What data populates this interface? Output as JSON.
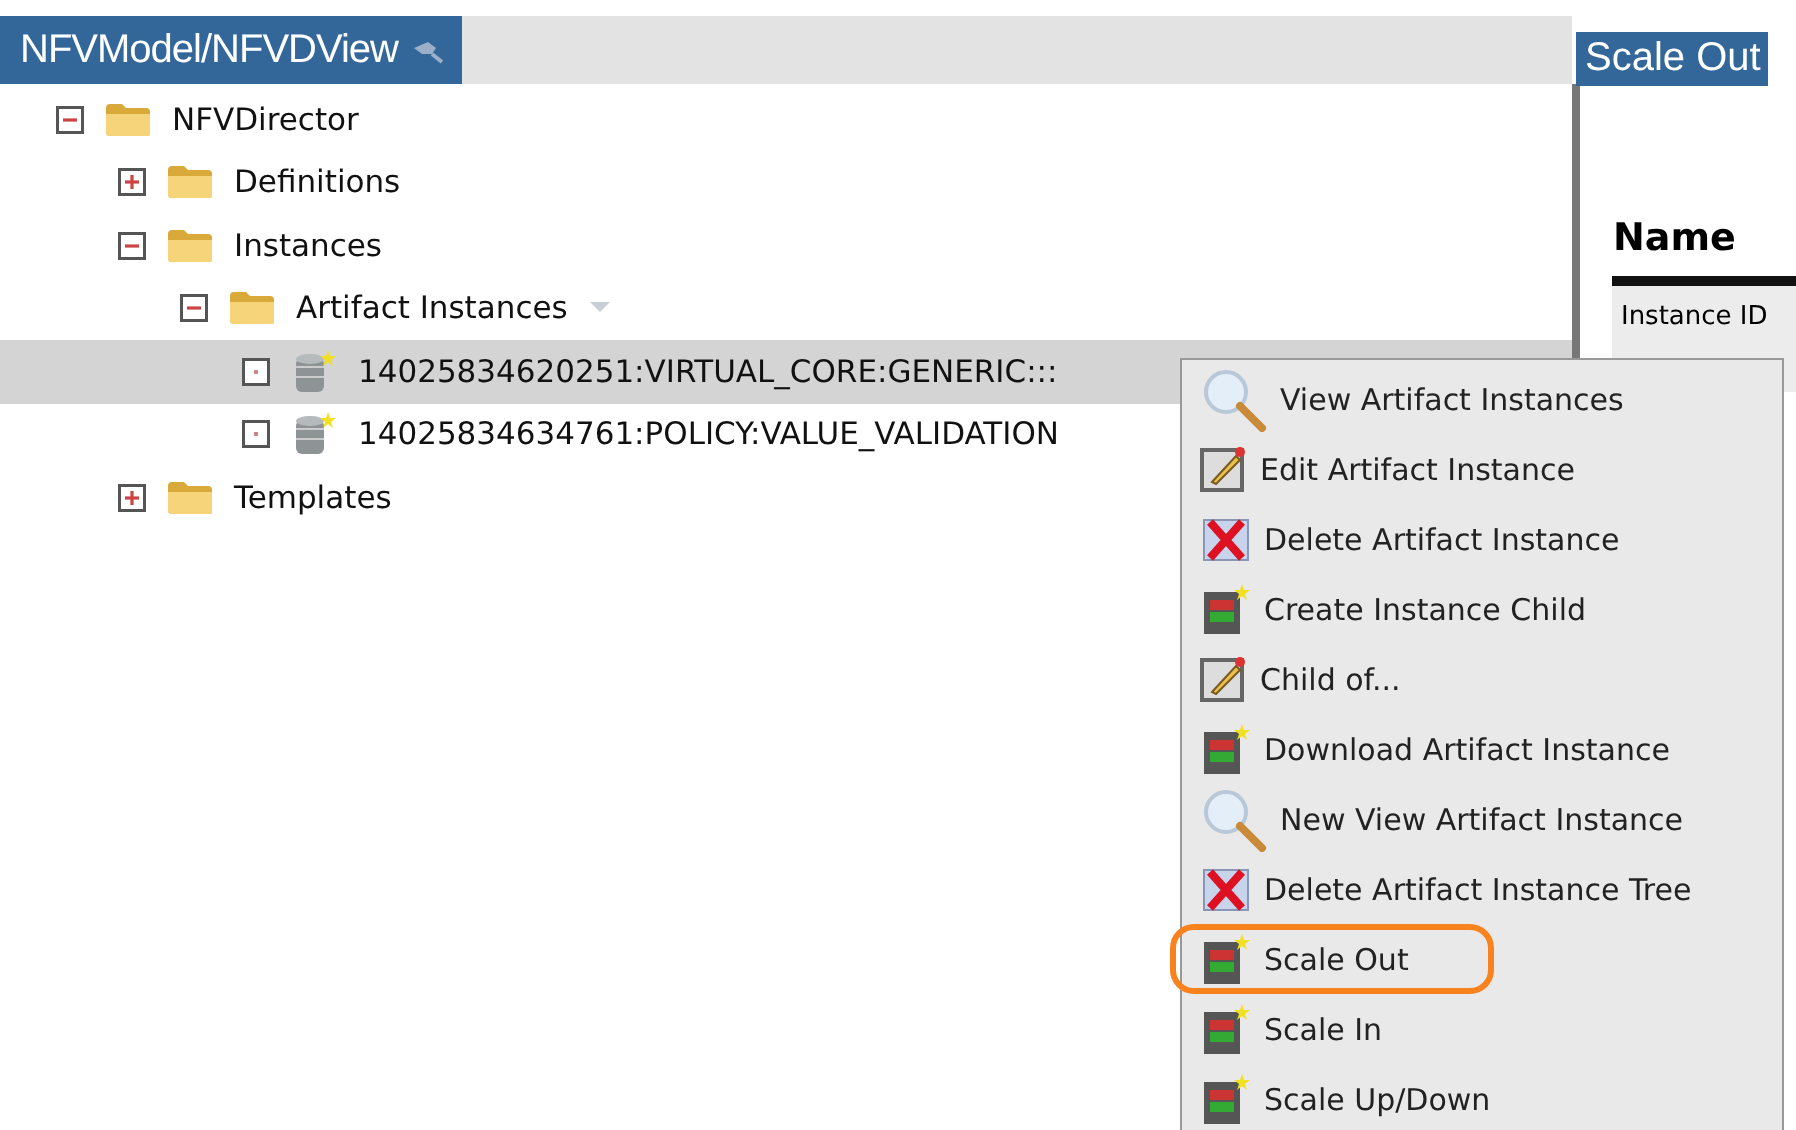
{
  "left_panel": {
    "title": "NFVModel/NFVDView"
  },
  "tree": [
    {
      "label": "NFVDirector",
      "kind": "folder",
      "expanded": true,
      "selected": false,
      "children": [
        {
          "label": "Definitions",
          "kind": "folder",
          "expanded": false,
          "selected": false
        },
        {
          "label": "Instances",
          "kind": "folder",
          "expanded": true,
          "selected": false,
          "children": [
            {
              "label": "Artifact Instances",
              "kind": "folder",
              "expanded": true,
              "selected": false,
              "has_menu": true,
              "children": [
                {
                  "label": "14025834620251:VIRTUAL_CORE:GENERIC:::",
                  "kind": "artifact",
                  "selected": true
                },
                {
                  "label": "14025834634761:POLICY:VALUE_VALIDATION",
                  "kind": "artifact",
                  "selected": false
                }
              ]
            }
          ]
        },
        {
          "label": "Templates",
          "kind": "folder",
          "expanded": false,
          "selected": false
        }
      ]
    }
  ],
  "right_panel": {
    "title": "Scale Out",
    "column_header": "Name",
    "row_label": "Instance ID"
  },
  "context_menu": [
    {
      "label": "View Artifact Instances",
      "kind": "search",
      "annotated": false
    },
    {
      "label": "Edit Artifact Instance",
      "kind": "edit",
      "annotated": false
    },
    {
      "label": "Delete Artifact Instance",
      "kind": "delete",
      "annotated": false
    },
    {
      "label": "Create Instance Child",
      "kind": "create",
      "annotated": false
    },
    {
      "label": "Child of...",
      "kind": "edit",
      "annotated": false
    },
    {
      "label": "Download Artifact Instance",
      "kind": "create",
      "annotated": false
    },
    {
      "label": "New View Artifact Instance",
      "kind": "search",
      "annotated": false
    },
    {
      "label": "Delete Artifact Instance Tree",
      "kind": "delete",
      "annotated": false
    },
    {
      "label": "Scale Out",
      "kind": "create",
      "annotated": true
    },
    {
      "label": "Scale In",
      "kind": "create",
      "annotated": false
    },
    {
      "label": "Scale Up/Down",
      "kind": "create",
      "annotated": false
    }
  ]
}
